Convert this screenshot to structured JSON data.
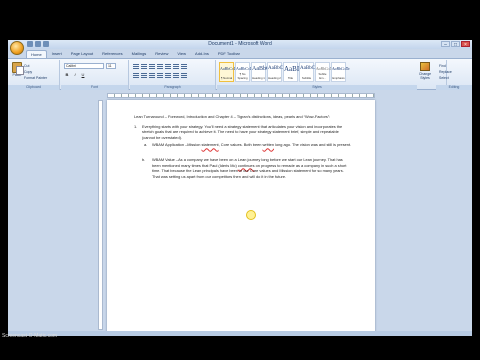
{
  "window": {
    "title": "Document1 - Microsoft Word",
    "minimize": "–",
    "maximize": "□",
    "close": "×",
    "icons": {
      "office_button": "office-logo-icon",
      "save": "save-icon",
      "undo": "undo-icon",
      "redo": "redo-icon"
    }
  },
  "tabs": [
    "Home",
    "Insert",
    "Page Layout",
    "References",
    "Mailings",
    "Review",
    "View",
    "Add-Ins",
    "PDF Toolbar"
  ],
  "ribbon": {
    "clipboard": {
      "paste": "Paste",
      "cut": "Cut",
      "copy": "Copy",
      "format_painter": "Format Painter",
      "label": "Clipboard"
    },
    "font": {
      "name": "Calibri",
      "size": "11",
      "bold": "B",
      "italic": "I",
      "underline": "U",
      "label": "Font"
    },
    "paragraph": {
      "label": "Paragraph"
    },
    "styles": {
      "items": [
        {
          "sample": "AaBbCcDc",
          "name": "¶ Normal"
        },
        {
          "sample": "AaBbCcDc",
          "name": "¶ No Spacing"
        },
        {
          "sample": "AaBbC",
          "name": "Heading 1"
        },
        {
          "sample": "AaBbCc",
          "name": "Heading 2"
        },
        {
          "sample": "AaBI",
          "name": "Title"
        },
        {
          "sample": "AaBbCc",
          "name": "Subtitle"
        },
        {
          "sample": "AaBbCcDc",
          "name": "Subtle Em..."
        },
        {
          "sample": "AaBbCcDc",
          "name": "Emphasis"
        }
      ],
      "change_styles": "Change Styles",
      "label": "Styles"
    },
    "editing": {
      "find": "Find",
      "replace": "Replace",
      "select": "Select",
      "label": "Editing"
    }
  },
  "document": {
    "title": "Lean Turnaround – Foreword, Introduction and Chapter 4 – Tigran’s distinctions, ideas, pearls and “Wow-Factors”:",
    "items": [
      {
        "number": "1.",
        "text": "Everything starts with your strategy. You’ll need a strategy statement that articulates your vision and incorporates the stretch goals that are required to achieve it. The need to have your strategy statement brief, simple and repeatable (cannot be overstated).",
        "subitems": [
          {
            "number": "a.",
            "text_before": "WBAM Application –Mission ",
            "text_squiggle_1": "statement",
            "text_middle": ", Core values. Both been ",
            "text_squiggle_2": "written",
            "text_after": " long ago. The vision was and still is present."
          },
          {
            "number": "b.",
            "text_before": "WBAM Value –As a company we have been on a Lean journey long before we start our Lean journey. That has been mentioned many times that Paul (Ideris Mc) ",
            "text_squiggle": "continues",
            "text_after": " on progress to remade as a company in such a short time. That because the Lean principals have been in our Core values and Mission statement for so many years. That was setting us apart from our competitors then and will do it in the future."
          }
        ]
      }
    ]
  },
  "watermark": "Screencast-O-Matic.com"
}
